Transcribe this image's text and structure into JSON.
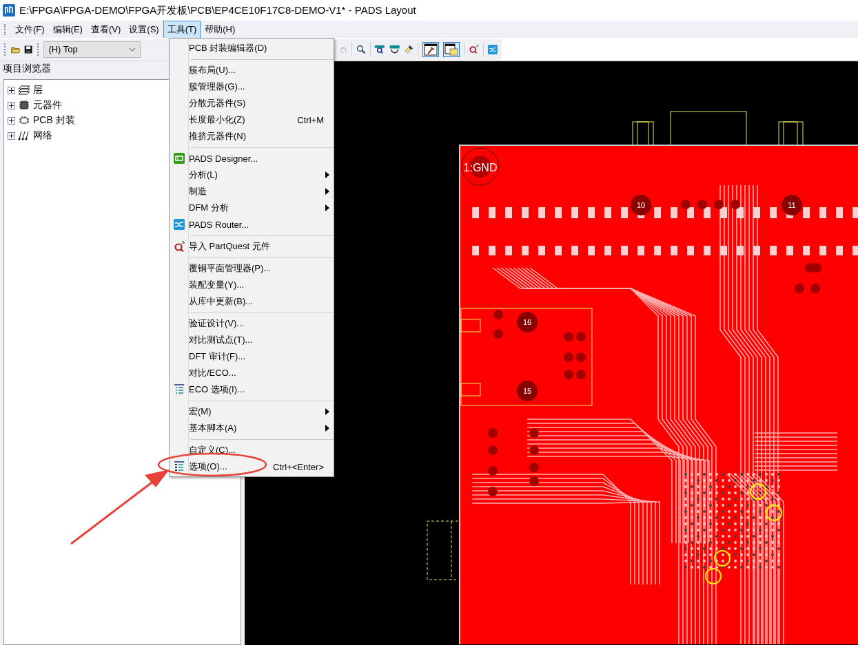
{
  "window": {
    "title": "E:\\FPGA\\FPGA-DEMO\\FPGA开发板\\PCB\\EP4CE10F17C8-DEMO-V1* - PADS Layout"
  },
  "menubar": [
    {
      "label": "文件(F)",
      "selected": false
    },
    {
      "label": "编辑(E)",
      "selected": false
    },
    {
      "label": "查看(V)",
      "selected": false
    },
    {
      "label": "设置(S)",
      "selected": false
    },
    {
      "label": "工具(T)",
      "selected": true
    },
    {
      "label": "帮助(H)",
      "selected": false
    }
  ],
  "toolbar": {
    "layer": "(H) Top",
    "toggles": [
      {
        "selected": true
      },
      {
        "selected": true
      }
    ]
  },
  "project_browser": {
    "title": "项目浏览器",
    "items": [
      {
        "label": "层",
        "kind": "layers",
        "expanded": false
      },
      {
        "label": "元器件",
        "kind": "parts",
        "expanded": false
      },
      {
        "label": "PCB 封装",
        "kind": "decals",
        "expanded": false
      },
      {
        "label": "网络",
        "kind": "nets",
        "expanded": false
      }
    ]
  },
  "tools_menu": [
    {
      "kind": "item",
      "label": "PCB 封装编辑器(D)"
    },
    {
      "kind": "separator"
    },
    {
      "kind": "item",
      "label": "簇布局(U)..."
    },
    {
      "kind": "item",
      "label": "簇管理器(G)..."
    },
    {
      "kind": "item",
      "label": "分散元器件(S)"
    },
    {
      "kind": "item",
      "label": "长度最小化(Z)",
      "shortcut": "Ctrl+M"
    },
    {
      "kind": "item",
      "label": "推挤元器件(N)"
    },
    {
      "kind": "separator"
    },
    {
      "kind": "item",
      "label": "PADS Designer..."
    },
    {
      "kind": "item",
      "label": "分析(L)",
      "submenu": true
    },
    {
      "kind": "item",
      "label": "制造",
      "submenu": true
    },
    {
      "kind": "item",
      "label": "DFM 分析",
      "submenu": true
    },
    {
      "kind": "item",
      "label": "PADS Router..."
    },
    {
      "kind": "separator"
    },
    {
      "kind": "item",
      "label": "导入 PartQuest 元件"
    },
    {
      "kind": "separator"
    },
    {
      "kind": "item",
      "label": "覆铜平面管理器(P)..."
    },
    {
      "kind": "item",
      "label": "装配变量(Y)..."
    },
    {
      "kind": "item",
      "label": "从库中更新(B)..."
    },
    {
      "kind": "separator"
    },
    {
      "kind": "item",
      "label": "验证设计(V)..."
    },
    {
      "kind": "item",
      "label": "对比测试点(T)..."
    },
    {
      "kind": "item",
      "label": "DFT 审计(F)..."
    },
    {
      "kind": "item",
      "label": "对比/ECO..."
    },
    {
      "kind": "item",
      "label": "ECO 选项(I)..."
    },
    {
      "kind": "separator"
    },
    {
      "kind": "item",
      "label": "宏(M)",
      "submenu": true
    },
    {
      "kind": "item",
      "label": "基本脚本(A)",
      "submenu": true
    },
    {
      "kind": "separator"
    },
    {
      "kind": "item",
      "label": "自定义(C)..."
    },
    {
      "kind": "item",
      "label": "选项(O)...",
      "shortcut": "Ctrl+<Enter>"
    }
  ],
  "pcb_canvas": {
    "pad_labels": [
      {
        "label": "1:GND",
        "kind": "ground"
      },
      {
        "label": "10",
        "kind": "hole"
      },
      {
        "label": "11",
        "kind": "hole"
      },
      {
        "label": "16",
        "kind": "hole"
      },
      {
        "label": "15",
        "kind": "hole"
      }
    ]
  }
}
